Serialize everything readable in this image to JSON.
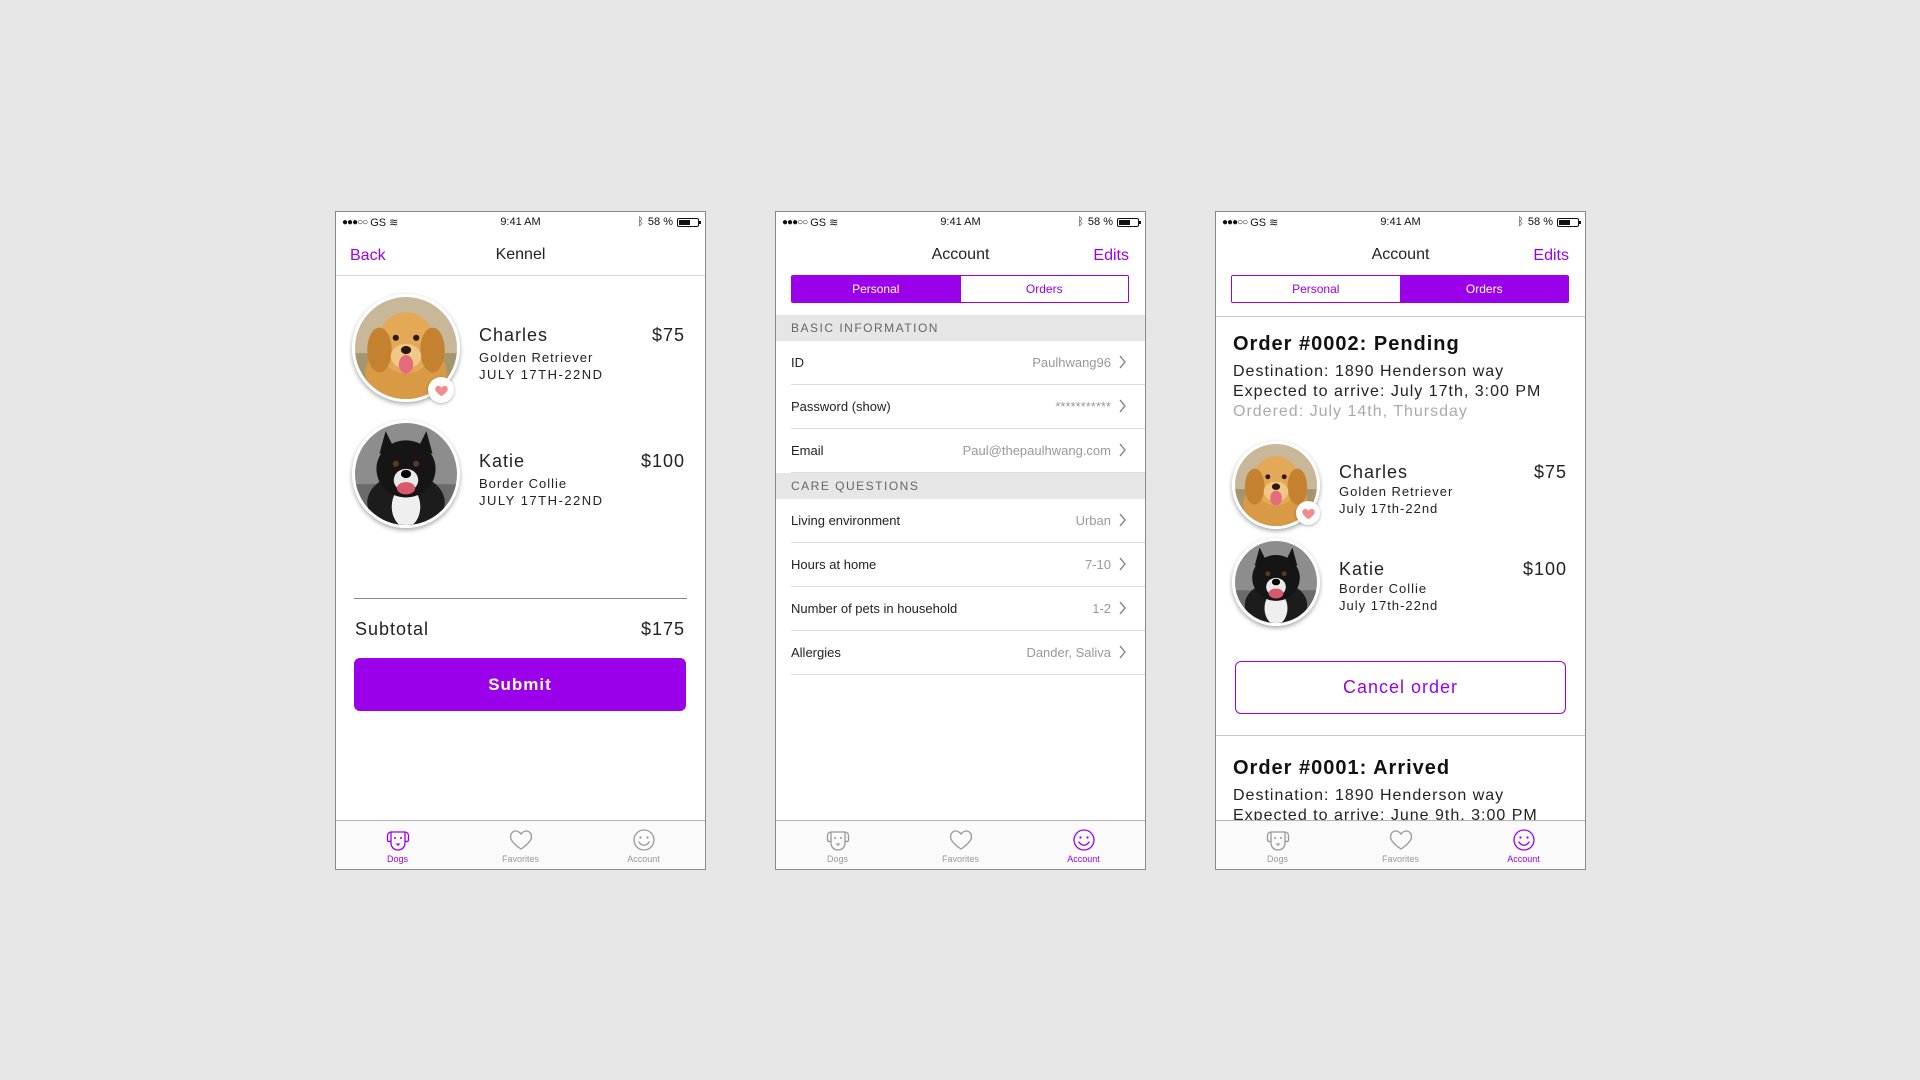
{
  "status_bar": {
    "carrier": "GS",
    "time": "9:41 AM",
    "battery": "58 %"
  },
  "colors": {
    "accent": "#9a00ea",
    "background": "#e6e6e6",
    "section_header": "#e6e6e6",
    "heart": "#f38b8b"
  },
  "tabbar": {
    "dogs": "Dogs",
    "favorites": "Favorites",
    "account": "Account"
  },
  "kennel": {
    "back": "Back",
    "title": "Kennel",
    "dogs": [
      {
        "name": "Charles",
        "breed": "Golden Retriever",
        "dates": "JULY 17TH-22ND",
        "price": "$75",
        "favorite": true
      },
      {
        "name": "Katie",
        "breed": "Border Collie",
        "dates": "JULY 17TH-22ND",
        "price": "$100",
        "favorite": false
      }
    ],
    "subtotal_label": "Subtotal",
    "subtotal_value": "$175",
    "submit": "Submit"
  },
  "account": {
    "title": "Account",
    "edit": "Edits",
    "tabs": {
      "personal": "Personal",
      "orders": "Orders"
    },
    "basic_header": "BASIC INFORMATION",
    "basic_rows": [
      {
        "label": "ID",
        "value": "Paulhwang96"
      },
      {
        "label": "Password (show)",
        "value": "***********"
      },
      {
        "label": "Email",
        "value": "Paul@thepaulhwang.com"
      }
    ],
    "care_header": "CARE QUESTIONS",
    "care_rows": [
      {
        "label": "Living environment",
        "value": "Urban"
      },
      {
        "label": "Hours at home",
        "value": "7-10"
      },
      {
        "label": "Number of pets in household",
        "value": "1-2"
      },
      {
        "label": "Allergies",
        "value": "Dander, Saliva"
      }
    ]
  },
  "orders": [
    {
      "title": "Order #0002: Pending",
      "destination": "Destination: 1890 Henderson way",
      "expected": "Expected to arrive: July 17th, 3:00 PM",
      "ordered": "Ordered: July 14th, Thursday",
      "dogs": [
        {
          "name": "Charles",
          "breed": "Golden Retriever",
          "dates": "July 17th-22nd",
          "price": "$75",
          "favorite": true
        },
        {
          "name": "Katie",
          "breed": "Border Collie",
          "dates": "July 17th-22nd",
          "price": "$100",
          "favorite": false
        }
      ],
      "cancel": "Cancel order"
    },
    {
      "title": "Order #0001: Arrived",
      "destination": "Destination: 1890 Henderson way",
      "expected": "Expected to arrive: June 9th, 3:00 PM"
    }
  ]
}
